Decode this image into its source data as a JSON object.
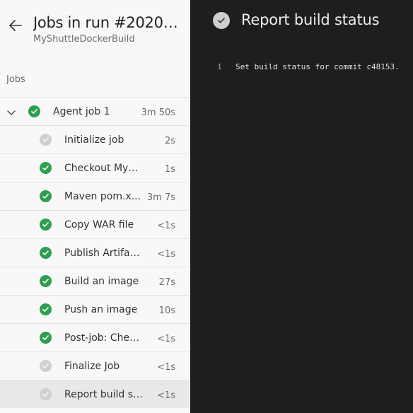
{
  "header": {
    "title": "Jobs in run #20200...",
    "subtitle": "MyShuttleDockerBuild"
  },
  "jobs_section_label": "Jobs",
  "agent_job": {
    "label": "Agent job 1",
    "duration": "3m 50s",
    "status": "success"
  },
  "steps": [
    {
      "label": "Initialize job",
      "duration": "2s",
      "status": "skipped"
    },
    {
      "label": "Checkout MyShu...",
      "duration": "1s",
      "status": "success"
    },
    {
      "label": "Maven pom.x...",
      "duration": "3m 7s",
      "status": "success"
    },
    {
      "label": "Copy WAR file",
      "duration": "<1s",
      "status": "success"
    },
    {
      "label": "Publish Artifact:...",
      "duration": "<1s",
      "status": "success"
    },
    {
      "label": "Build an image",
      "duration": "27s",
      "status": "success"
    },
    {
      "label": "Push an image",
      "duration": "10s",
      "status": "success"
    },
    {
      "label": "Post-job: Check...",
      "duration": "<1s",
      "status": "success"
    },
    {
      "label": "Finalize Job",
      "duration": "<1s",
      "status": "skipped"
    },
    {
      "label": "Report build st...",
      "duration": "<1s",
      "status": "skipped",
      "selected": true
    }
  ],
  "detail": {
    "title": "Report build status",
    "log_lines": [
      {
        "number": "1",
        "text": "Set build status for commit c48153."
      }
    ]
  },
  "colors": {
    "success": "#2f9e4f",
    "skipped": "#cfcfcf",
    "log_background": "#1e1e1e",
    "panel_background": "#f8f8f8"
  }
}
